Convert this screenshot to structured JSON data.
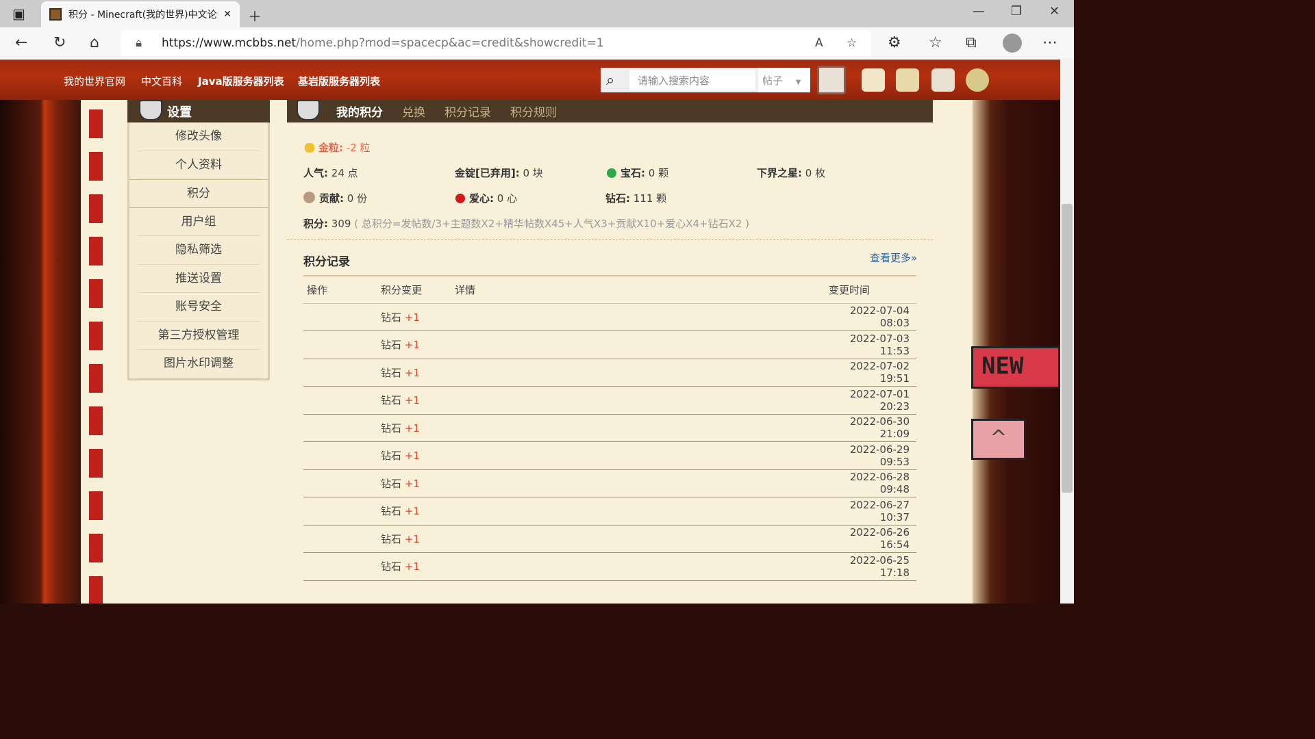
{
  "browser": {
    "tab_title": "积分 - Minecraft(我的世界)中文论坛",
    "url_domain": "https://www.mcbbs.net",
    "url_path": "/home.php?mod=spacecp&ac=credit&showcredit=1"
  },
  "site_nav": [
    "我的世界官网",
    "中文百科",
    "Java版服务器列表",
    "基岩版服务器列表"
  ],
  "search": {
    "placeholder": "请输入搜索内容",
    "type": "帖子"
  },
  "sidebar": {
    "title": "设置",
    "items": [
      "修改头像",
      "个人资料",
      "积分",
      "用户组",
      "隐私筛选",
      "推送设置",
      "账号安全",
      "第三方授权管理",
      "图片水印调整"
    ],
    "active": "积分"
  },
  "main_tabs": {
    "current": "我的积分",
    "others": [
      "兑换",
      "积分记录",
      "积分规则"
    ]
  },
  "credits": {
    "gold_nugget": {
      "label": "金粒:",
      "value": "-2 粒"
    },
    "popularity": {
      "label": "人气:",
      "value": "24 点"
    },
    "gold_ingot": {
      "label": "金锭[已弃用]:",
      "value": "0 块"
    },
    "gem": {
      "label": "宝石:",
      "value": "0 颗"
    },
    "nether_star": {
      "label": "下界之星:",
      "value": "0 枚"
    },
    "contribution": {
      "label": "贡献:",
      "value": "0 份"
    },
    "love": {
      "label": "爱心:",
      "value": "0 心"
    },
    "diamond": {
      "label": "钻石:",
      "value": "111 颗"
    },
    "total": {
      "label": "积分:",
      "value": "309",
      "formula": "( 总积分=发帖数/3+主题数X2+精华帖数X45+人气X3+贡献X10+爱心X4+钻石X2 )"
    }
  },
  "records": {
    "title": "积分记录",
    "more": "查看更多»",
    "headers": [
      "操作",
      "积分变更",
      "详情",
      "变更时间"
    ],
    "rows": [
      {
        "credit": "钻石",
        "change": "+1",
        "time": "2022-07-04 08:03"
      },
      {
        "credit": "钻石",
        "change": "+1",
        "time": "2022-07-03 11:53"
      },
      {
        "credit": "钻石",
        "change": "+1",
        "time": "2022-07-02 19:51"
      },
      {
        "credit": "钻石",
        "change": "+1",
        "time": "2022-07-01 20:23"
      },
      {
        "credit": "钻石",
        "change": "+1",
        "time": "2022-06-30 21:09"
      },
      {
        "credit": "钻石",
        "change": "+1",
        "time": "2022-06-29 09:53"
      },
      {
        "credit": "钻石",
        "change": "+1",
        "time": "2022-06-28 09:48"
      },
      {
        "credit": "钻石",
        "change": "+1",
        "time": "2022-06-27 10:37"
      },
      {
        "credit": "钻石",
        "change": "+1",
        "time": "2022-06-26 16:54"
      },
      {
        "credit": "钻石",
        "change": "+1",
        "time": "2022-06-25 17:18"
      }
    ]
  },
  "badge_new": "NEW"
}
